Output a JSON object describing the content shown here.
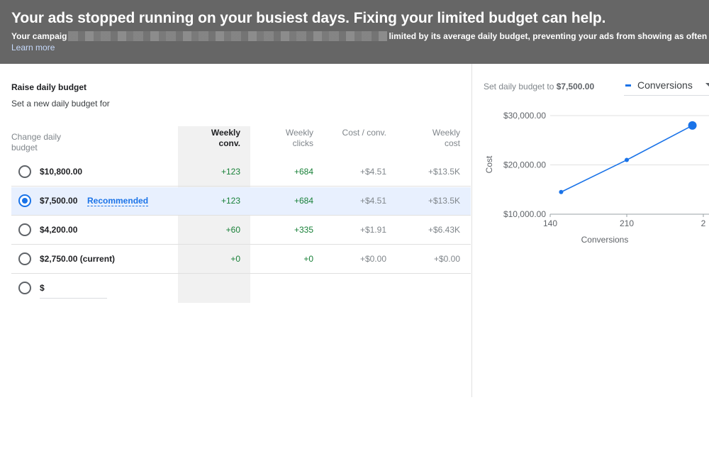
{
  "banner": {
    "title": "Your ads stopped running on your busiest days. Fixing your limited budget can help.",
    "msg_prefix": "Your campaig",
    "msg_suffix": "limited by its average daily budget, preventing your ads from showing as often as they c",
    "learn_more": "Learn more"
  },
  "left": {
    "title": "Raise daily budget",
    "subtitle": "Set a new daily budget for",
    "headers": {
      "budget_line1": "Change daily",
      "budget_line2": "budget",
      "conv_line1": "Weekly",
      "conv_line2": "conv.",
      "clicks_line1": "Weekly",
      "clicks_line2": "clicks",
      "cost_conv": "Cost / conv.",
      "cost_line1": "Weekly",
      "cost_line2": "cost"
    },
    "rows": [
      {
        "budget": "$10,800.00",
        "conv": "+123",
        "clicks": "+684",
        "cost_conv": "+$4.51",
        "cost": "+$13.5K"
      },
      {
        "budget": "$7,500.00",
        "badge": "Recommended",
        "conv": "+123",
        "clicks": "+684",
        "cost_conv": "+$4.51",
        "cost": "+$13.5K",
        "selected": true
      },
      {
        "budget": "$4,200.00",
        "conv": "+60",
        "clicks": "+335",
        "cost_conv": "+$1.91",
        "cost": "+$6.43K"
      },
      {
        "budget": "$2,750.00 (current)",
        "conv": "+0",
        "clicks": "+0",
        "cost_conv": "+$0.00",
        "cost": "+$0.00"
      }
    ],
    "custom_prefix": "$"
  },
  "right": {
    "set_to_prefix": "Set daily budget to",
    "set_to_value": "$7,500.00",
    "metric": "Conversions"
  },
  "colors": {
    "banner_bg": "#666666",
    "accent": "#1a73e8",
    "positive": "#188038",
    "selected_row": "#e8f0fe"
  },
  "chart_data": {
    "type": "line",
    "xlabel": "Conversions",
    "ylabel": "Cost",
    "x_ticks": [
      "140",
      "210",
      "2"
    ],
    "y_ticks": [
      "$10,000.00",
      "$20,000.00",
      "$30,000.00"
    ],
    "xlim": [
      140,
      280
    ],
    "ylim": [
      10000,
      30000
    ],
    "series": [
      {
        "name": "Conversions",
        "x": [
          150,
          210,
          270
        ],
        "y": [
          14500,
          21000,
          28000
        ]
      }
    ],
    "highlight_index": 2
  }
}
